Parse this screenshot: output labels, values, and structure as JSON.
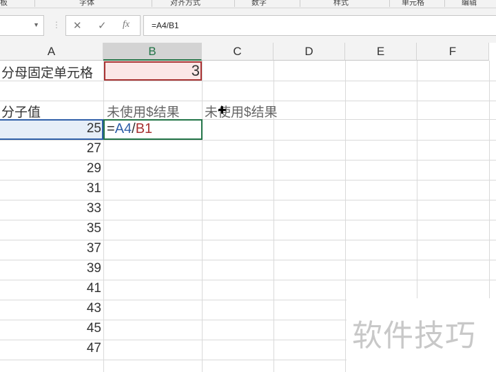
{
  "ribbon": {
    "groups": [
      "板",
      "字体",
      "对齐方式",
      "数字",
      "样式",
      "单元格",
      "编辑"
    ]
  },
  "formula_bar": {
    "name_box": "",
    "cancel_icon": "✕",
    "enter_icon": "✓",
    "fx_label": "fx",
    "formula": "=A4/B1"
  },
  "columns": [
    "A",
    "B",
    "C",
    "D",
    "E",
    "F"
  ],
  "cells": {
    "A1": "分母固定单元格",
    "B1": "3",
    "A3": "分子值",
    "B3": "未使用$结果",
    "C3": "未使用$结果",
    "B4_eq": "=",
    "B4_ref1": "A4",
    "B4_slash": "/",
    "B4_ref2": "B1"
  },
  "numerators": [
    "25",
    "27",
    "29",
    "31",
    "33",
    "35",
    "37",
    "39",
    "41",
    "43",
    "45",
    "47"
  ],
  "watermark": "软件技巧",
  "colors": {
    "selected_border": "#217346",
    "ref_blue": "#2f5fa8",
    "ref_red": "#a83232"
  }
}
